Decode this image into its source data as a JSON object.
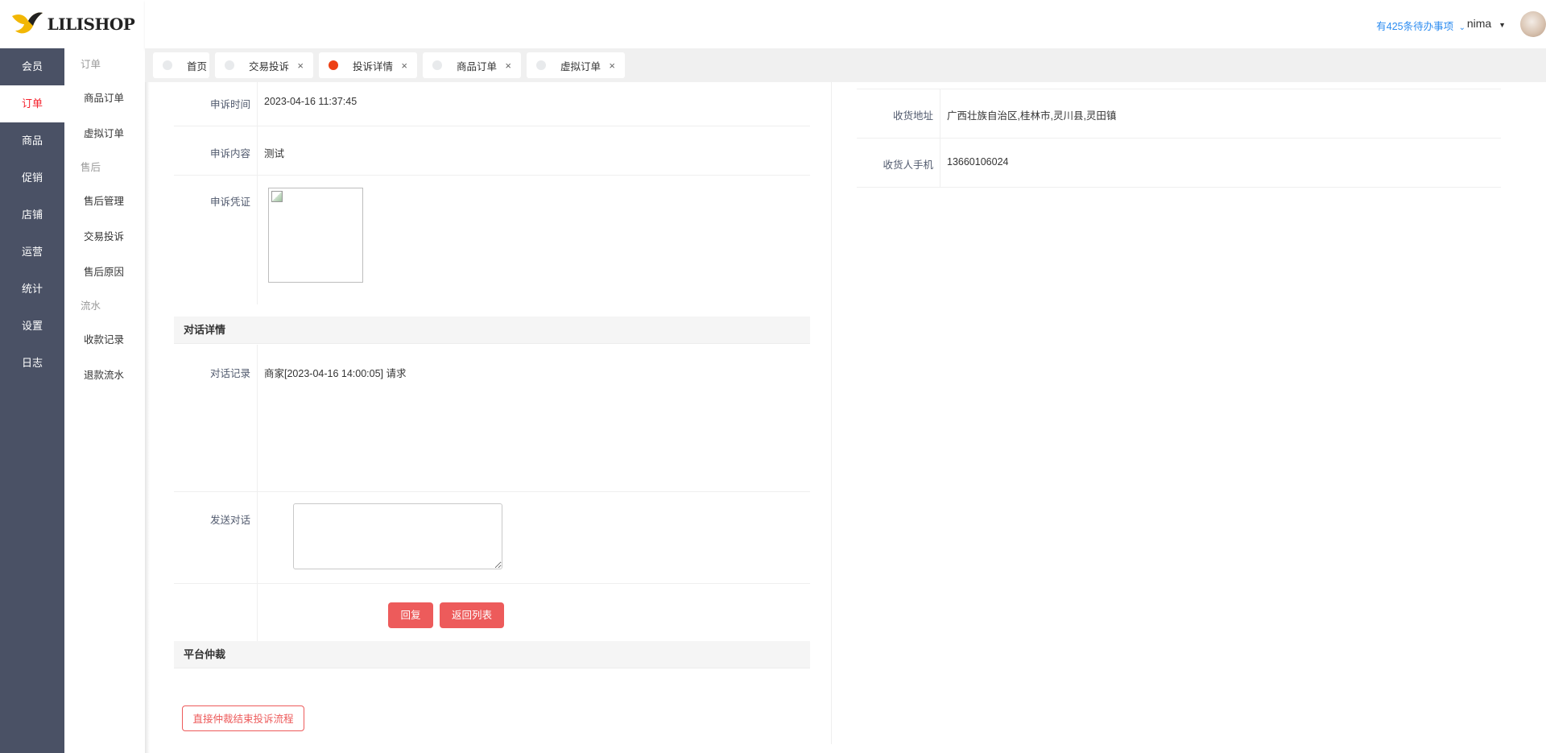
{
  "logo": {
    "text": "LILISHOP"
  },
  "main_nav": [
    {
      "label": "会员",
      "active": false
    },
    {
      "label": "订单",
      "active": true
    },
    {
      "label": "商品",
      "active": false
    },
    {
      "label": "促销",
      "active": false
    },
    {
      "label": "店铺",
      "active": false
    },
    {
      "label": "运营",
      "active": false
    },
    {
      "label": "统计",
      "active": false
    },
    {
      "label": "设置",
      "active": false
    },
    {
      "label": "日志",
      "active": false
    }
  ],
  "sub_nav": {
    "group_order": "订单",
    "order_items": [
      "商品订单",
      "虚拟订单"
    ],
    "group_after_sale": "售后",
    "after_sale_items": [
      "售后管理",
      "交易投诉",
      "售后原因"
    ],
    "group_flow": "流水",
    "flow_items": [
      "收款记录",
      "退款流水"
    ]
  },
  "header": {
    "todo": "有425条待办事项",
    "user": "nima"
  },
  "tabs": [
    {
      "label": "首页",
      "closable": false,
      "active": false
    },
    {
      "label": "交易投诉",
      "closable": true,
      "active": false
    },
    {
      "label": "投诉详情",
      "closable": true,
      "active": true
    },
    {
      "label": "商品订单",
      "closable": true,
      "active": false
    },
    {
      "label": "虚拟订单",
      "closable": true,
      "active": false
    }
  ],
  "close_glyph": "×",
  "complaint": {
    "appeal_time_label": "申诉时间",
    "appeal_time": "2023-04-16 11:37:45",
    "appeal_content_label": "申诉内容",
    "appeal_content": "测试",
    "appeal_evidence_label": "申诉凭证"
  },
  "dialog": {
    "section_title": "对话详情",
    "record_label": "对话记录",
    "record": "商家[2023-04-16 14:00:05] 请求",
    "send_label": "发送对话",
    "send_value": "",
    "reply_button": "回复",
    "back_button": "返回列表"
  },
  "arbitration": {
    "section_title": "平台仲裁",
    "end_button": "直接仲裁结束投诉流程"
  },
  "receiver": {
    "address_label": "收货地址",
    "address": "广西壮族自治区,桂林市,灵川县,灵田镇",
    "phone_label": "收货人手机",
    "phone": "13660106024"
  },
  "colors": {
    "sidebar_bg": "#4a5165",
    "accent_red": "#ed5b5b",
    "active_red": "#f5222d",
    "link_blue": "#2d8cf0"
  }
}
